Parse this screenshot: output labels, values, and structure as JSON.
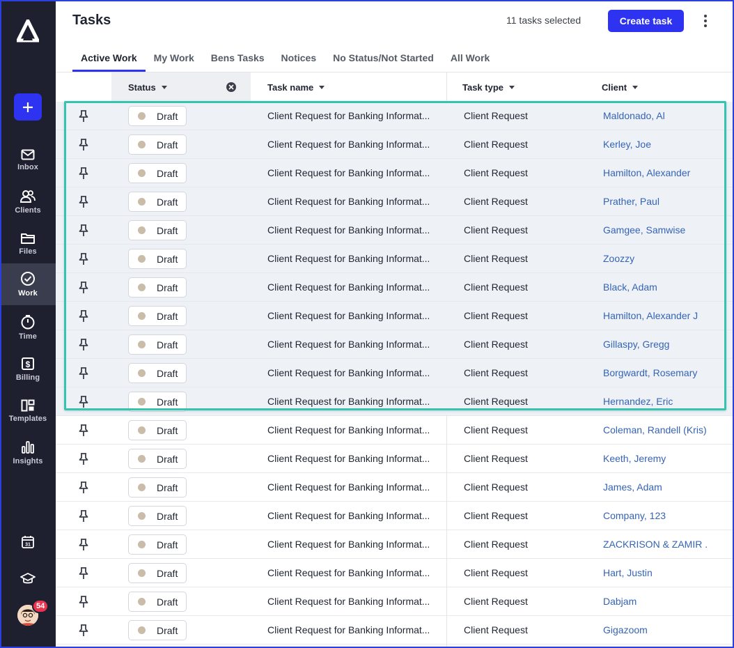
{
  "header": {
    "title": "Tasks",
    "selected_count": "11 tasks selected",
    "create_label": "Create task"
  },
  "sidebar": {
    "items": [
      {
        "label": "Inbox",
        "icon": "mail-icon"
      },
      {
        "label": "Clients",
        "icon": "people-icon"
      },
      {
        "label": "Files",
        "icon": "folder-icon"
      },
      {
        "label": "Work",
        "icon": "check-circle-icon"
      },
      {
        "label": "Time",
        "icon": "timer-icon"
      },
      {
        "label": "Billing",
        "icon": "dollar-icon"
      },
      {
        "label": "Templates",
        "icon": "templates-icon"
      },
      {
        "label": "Insights",
        "icon": "bar-chart-icon"
      }
    ],
    "active": "Work",
    "calendar_day": "31",
    "notification_count": "54"
  },
  "tabs": [
    "Active Work",
    "My Work",
    "Bens Tasks",
    "Notices",
    "No Status/Not Started",
    "All Work"
  ],
  "active_tab": "Active Work",
  "table": {
    "columns": [
      "Status",
      "Task name",
      "Task type",
      "Client"
    ],
    "rows": [
      {
        "status": "Draft",
        "name": "Client Request for Banking Informat...",
        "type": "Client Request",
        "client": "Maldonado, Al",
        "selected": true
      },
      {
        "status": "Draft",
        "name": "Client Request for Banking Informat...",
        "type": "Client Request",
        "client": "Kerley, Joe",
        "selected": true
      },
      {
        "status": "Draft",
        "name": "Client Request for Banking Informat...",
        "type": "Client Request",
        "client": "Hamilton, Alexander",
        "selected": true
      },
      {
        "status": "Draft",
        "name": "Client Request for Banking Informat...",
        "type": "Client Request",
        "client": "Prather, Paul",
        "selected": true
      },
      {
        "status": "Draft",
        "name": "Client Request for Banking Informat...",
        "type": "Client Request",
        "client": "Gamgee, Samwise",
        "selected": true
      },
      {
        "status": "Draft",
        "name": "Client Request for Banking Informat...",
        "type": "Client Request",
        "client": "Zoozzy",
        "selected": true
      },
      {
        "status": "Draft",
        "name": "Client Request for Banking Informat...",
        "type": "Client Request",
        "client": "Black, Adam",
        "selected": true
      },
      {
        "status": "Draft",
        "name": "Client Request for Banking Informat...",
        "type": "Client Request",
        "client": "Hamilton, Alexander J",
        "selected": true
      },
      {
        "status": "Draft",
        "name": "Client Request for Banking Informat...",
        "type": "Client Request",
        "client": "Gillaspy, Gregg",
        "selected": true
      },
      {
        "status": "Draft",
        "name": "Client Request for Banking Informat...",
        "type": "Client Request",
        "client": "Borgwardt, Rosemary",
        "selected": true
      },
      {
        "status": "Draft",
        "name": "Client Request for Banking Informat...",
        "type": "Client Request",
        "client": "Hernandez, Eric",
        "selected": true
      },
      {
        "status": "Draft",
        "name": "Client Request for Banking Informat...",
        "type": "Client Request",
        "client": "Coleman, Randell (Kris)",
        "selected": false
      },
      {
        "status": "Draft",
        "name": "Client Request for Banking Informat...",
        "type": "Client Request",
        "client": "Keeth, Jeremy",
        "selected": false
      },
      {
        "status": "Draft",
        "name": "Client Request for Banking Informat...",
        "type": "Client Request",
        "client": "James, Adam",
        "selected": false
      },
      {
        "status": "Draft",
        "name": "Client Request for Banking Informat...",
        "type": "Client Request",
        "client": "Company, 123",
        "selected": false
      },
      {
        "status": "Draft",
        "name": "Client Request for Banking Informat...",
        "type": "Client Request",
        "client": "ZACKRISON & ZAMIR ...",
        "selected": false
      },
      {
        "status": "Draft",
        "name": "Client Request for Banking Informat...",
        "type": "Client Request",
        "client": "Hart, Justin",
        "selected": false
      },
      {
        "status": "Draft",
        "name": "Client Request for Banking Informat...",
        "type": "Client Request",
        "client": "Dabjam",
        "selected": false
      },
      {
        "status": "Draft",
        "name": "Client Request for Banking Informat...",
        "type": "Client Request",
        "client": "Gigazoom",
        "selected": false
      }
    ]
  },
  "colors": {
    "accent": "#2d33f0",
    "sidebar_bg": "#1e2030",
    "selection_outline": "#35c4b0",
    "client_link": "#3563b5",
    "draft_dot": "#c9bca9",
    "badge": "#e8344e"
  }
}
